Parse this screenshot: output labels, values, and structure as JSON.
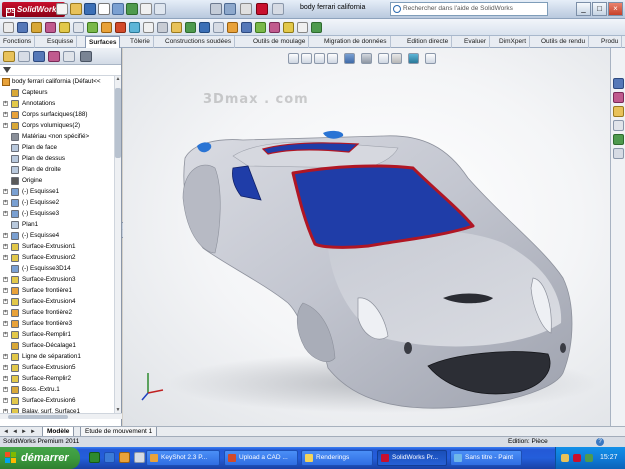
{
  "app": {
    "logo_text": "SolidWorks",
    "document_title": "body ferrari california",
    "search_placeholder": "Rechercher dans l'aide de SolidWorks",
    "window_buttons": [
      "_",
      "□",
      "×"
    ]
  },
  "ribbon_tabs": [
    {
      "label": "Fonctions",
      "active": false
    },
    {
      "label": "Esquisse",
      "active": false
    },
    {
      "label": "Surfaces",
      "active": true
    },
    {
      "label": "Tôlerie",
      "active": false
    },
    {
      "label": "Constructions soudées",
      "active": false
    },
    {
      "label": "Outils de moulage",
      "active": false
    },
    {
      "label": "Migration de données",
      "active": false
    },
    {
      "label": "Edition directe",
      "active": false
    },
    {
      "label": "Evaluer",
      "active": false
    },
    {
      "label": "DimXpert",
      "active": false
    },
    {
      "label": "Outils de rendu",
      "active": false
    },
    {
      "label": "Produ",
      "active": false
    }
  ],
  "watermark": "3Dmax . com",
  "tree": {
    "root": "body ferrari california  (Défaut<<",
    "items": [
      {
        "label": "Capteurs",
        "expand": false,
        "icon": "sensor-icon"
      },
      {
        "label": "Annotations",
        "expand": true,
        "icon": "annotations-icon"
      },
      {
        "label": "Corps surfaciques(188)",
        "expand": true,
        "icon": "surface-bodies-icon"
      },
      {
        "label": "Corps volumiques(2)",
        "expand": true,
        "icon": "solid-bodies-icon"
      },
      {
        "label": "Matériau <non spécifié>",
        "expand": false,
        "icon": "material-icon"
      },
      {
        "label": "Plan de face",
        "expand": false,
        "icon": "plane-icon"
      },
      {
        "label": "Plan de dessus",
        "expand": false,
        "icon": "plane-icon"
      },
      {
        "label": "Plan de droite",
        "expand": false,
        "icon": "plane-icon"
      },
      {
        "label": "Origine",
        "expand": false,
        "icon": "origin-icon"
      },
      {
        "label": "(-) Esquisse1",
        "expand": true,
        "icon": "sketch-icon"
      },
      {
        "label": "(-) Esquisse2",
        "expand": true,
        "icon": "sketch-icon"
      },
      {
        "label": "(-) Esquisse3",
        "expand": true,
        "icon": "sketch-icon"
      },
      {
        "label": "Plan1",
        "expand": false,
        "icon": "plane-icon"
      },
      {
        "label": "(-) Esquisse4",
        "expand": true,
        "icon": "sketch-icon"
      },
      {
        "label": "Surface-Extrusion1",
        "expand": true,
        "icon": "surface-feature-icon"
      },
      {
        "label": "Surface-Extrusion2",
        "expand": true,
        "icon": "surface-feature-icon"
      },
      {
        "label": "(-) Esquisse3D14",
        "expand": false,
        "icon": "sketch3d-icon"
      },
      {
        "label": "Surface-Extrusion3",
        "expand": true,
        "icon": "surface-feature-icon"
      },
      {
        "label": "Surface frontière1",
        "expand": true,
        "icon": "boundary-surface-icon"
      },
      {
        "label": "Surface-Extrusion4",
        "expand": true,
        "icon": "surface-feature-icon"
      },
      {
        "label": "Surface frontière2",
        "expand": true,
        "icon": "boundary-surface-icon"
      },
      {
        "label": "Surface frontière3",
        "expand": true,
        "icon": "boundary-surface-icon"
      },
      {
        "label": "Surface-Remplir1",
        "expand": true,
        "icon": "fill-surface-icon"
      },
      {
        "label": "Surface-Décalage1",
        "expand": false,
        "icon": "offset-surface-icon"
      },
      {
        "label": "Ligne de séparation1",
        "expand": true,
        "icon": "split-line-icon"
      },
      {
        "label": "Surface-Extrusion5",
        "expand": true,
        "icon": "surface-feature-icon"
      },
      {
        "label": "Surface-Remplir2",
        "expand": true,
        "icon": "fill-surface-icon"
      },
      {
        "label": "Boss.-Extru.1",
        "expand": true,
        "icon": "boss-extrude-icon"
      },
      {
        "label": "Surface-Extrusion6",
        "expand": true,
        "icon": "surface-feature-icon"
      },
      {
        "label": "Balay. surf. Surface1",
        "expand": true,
        "icon": "sweep-surface-icon"
      }
    ]
  },
  "bottom_tabs": [
    {
      "label": "Modèle",
      "active": true
    },
    {
      "label": "Etude de mouvement 1",
      "active": false
    }
  ],
  "status": {
    "left": "SolidWorks Premium 2011",
    "right": "Edition: Pièce",
    "help": "?"
  },
  "taskbar": {
    "start_label": "démarrer",
    "buttons": [
      {
        "label": "KeyShot 2.3 P...",
        "active": false,
        "color": "#e8a23a"
      },
      {
        "label": "Upload a CAD ...",
        "active": false,
        "color": "#d24a2a"
      },
      {
        "label": "Renderings",
        "active": false,
        "color": "#f2d45c"
      },
      {
        "label": "SolidWorks Pr...",
        "active": true,
        "color": "#c8102e"
      },
      {
        "label": "Sans titre - Paint",
        "active": false,
        "color": "#6fb7e9"
      }
    ],
    "clock": "15:27"
  },
  "colors": {
    "body": "#c9cbd5",
    "glass": "#1f3da8",
    "trim": "#b01624"
  }
}
